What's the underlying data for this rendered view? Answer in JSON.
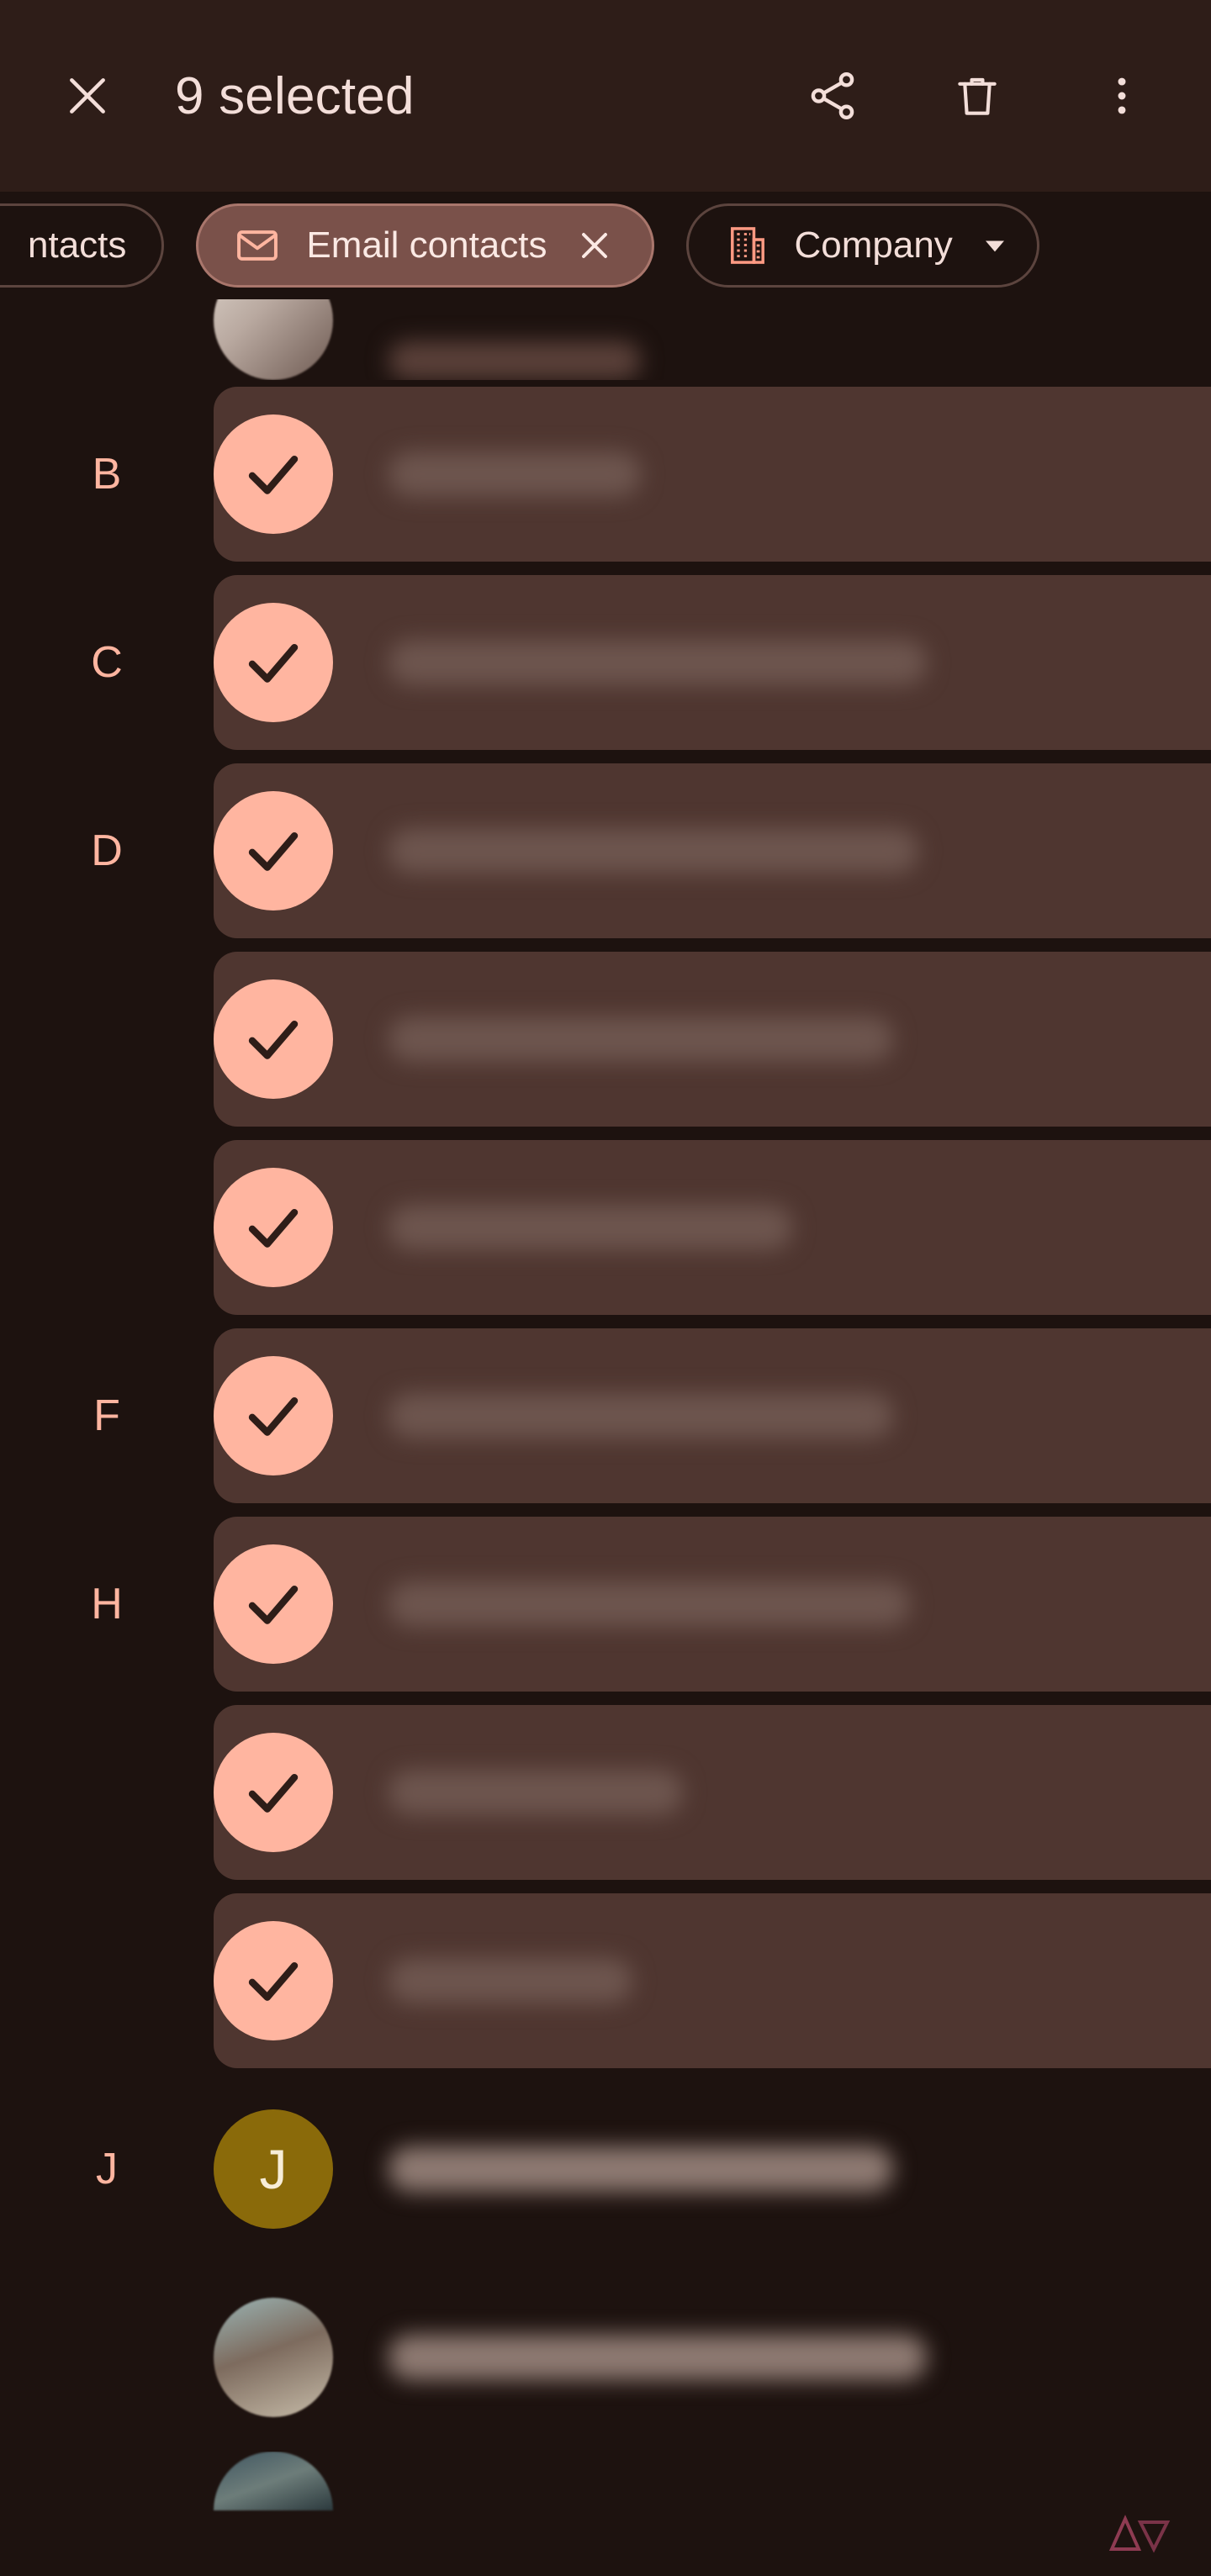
{
  "appbar": {
    "close_icon": "close-icon",
    "title": "9 selected",
    "actions": [
      {
        "icon": "share-icon",
        "label": "Share"
      },
      {
        "icon": "trash-icon",
        "label": "Delete"
      },
      {
        "icon": "overflow-menu-icon",
        "label": "More options"
      }
    ]
  },
  "filters": {
    "chips": [
      {
        "id": "contacts",
        "label": "ntacts",
        "state": "outline",
        "partial": true
      },
      {
        "id": "email-contacts",
        "label": "Email contacts",
        "state": "selected",
        "leading_icon": "envelope-icon",
        "trailing_icon": "close-icon"
      },
      {
        "id": "company",
        "label": "Company",
        "state": "outline",
        "leading_icon": "building-icon",
        "trailing_icon": "chevron-down-icon"
      }
    ]
  },
  "list": {
    "rows": [
      {
        "kind": "partial-top",
        "section": "",
        "avatar": "photo-a",
        "name_width": 300,
        "selected": false
      },
      {
        "kind": "row",
        "section": "B",
        "avatar": "check",
        "name_width": 300,
        "selected": true
      },
      {
        "kind": "row",
        "section": "C",
        "avatar": "check",
        "name_width": 640,
        "selected": true
      },
      {
        "kind": "row",
        "section": "D",
        "avatar": "check",
        "name_width": 630,
        "selected": true
      },
      {
        "kind": "row",
        "section": "",
        "avatar": "check",
        "name_width": 600,
        "selected": true
      },
      {
        "kind": "row",
        "section": "",
        "avatar": "check",
        "name_width": 480,
        "selected": true
      },
      {
        "kind": "row",
        "section": "F",
        "avatar": "check",
        "name_width": 600,
        "selected": true
      },
      {
        "kind": "row",
        "section": "H",
        "avatar": "check",
        "name_width": 620,
        "selected": true
      },
      {
        "kind": "row",
        "section": "",
        "avatar": "check",
        "name_width": 350,
        "selected": true
      },
      {
        "kind": "row",
        "section": "",
        "avatar": "check",
        "name_width": 290,
        "selected": true
      },
      {
        "kind": "row",
        "section": "J",
        "avatar": "letter",
        "avatar_letter": "J",
        "name_width": 600,
        "selected": false
      },
      {
        "kind": "row",
        "section": "",
        "avatar": "photo-b",
        "name_width": 640,
        "selected": false
      },
      {
        "kind": "partial-bottom",
        "section": "",
        "avatar": "photo-c",
        "name_width": 0,
        "selected": false
      }
    ]
  },
  "colors": {
    "background": "#1d120f",
    "appbar": "#2e1d18",
    "accent": "#ffb5a0",
    "selected_row": "#4f3630",
    "chip_selected": "#7a514a",
    "on_surface": "#f3ded9"
  },
  "watermark": {
    "name": "android-police-logo"
  }
}
